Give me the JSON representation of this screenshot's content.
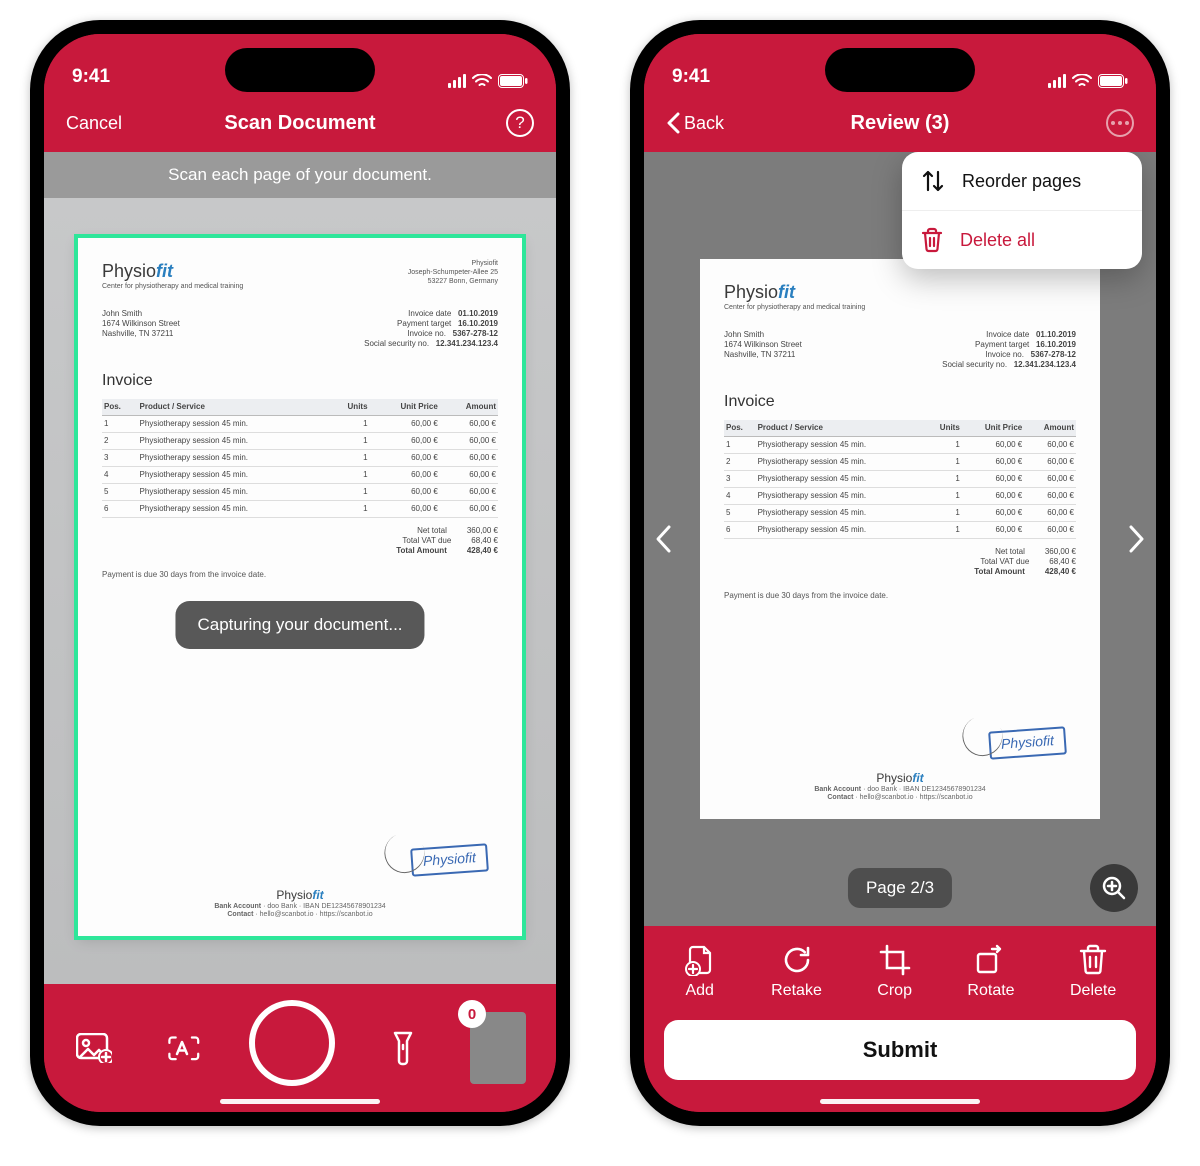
{
  "status": {
    "time": "9:41"
  },
  "scan": {
    "cancel": "Cancel",
    "title": "Scan Document",
    "hint": "Scan each page of your document.",
    "toast": "Capturing your document...",
    "thumb_count": "0"
  },
  "review": {
    "back": "Back",
    "title": "Review (3)",
    "page_chip": "Page 2/3",
    "menu": {
      "reorder": "Reorder pages",
      "delete_all": "Delete all"
    },
    "tools": {
      "add": "Add",
      "retake": "Retake",
      "crop": "Crop",
      "rotate": "Rotate",
      "delete": "Delete"
    },
    "submit": "Submit"
  },
  "doc": {
    "brand": "Physio",
    "brand_accent": "fit",
    "tag": "Center for physiotherapy and medical training",
    "company_addr": [
      "Physiofit",
      "Joseph-Schumpeter-Allee 25",
      "53227 Bonn, Germany"
    ],
    "client": [
      "John Smith",
      "1674 Wilkinson Street",
      "Nashville, TN 37211"
    ],
    "meta_labels": [
      "Invoice date",
      "Payment target",
      "Invoice no.",
      "Social security no."
    ],
    "meta_values": [
      "01.10.2019",
      "16.10.2019",
      "5367-278-12",
      "12.341.234.123.4"
    ],
    "invoice_word": "Invoice",
    "cols": [
      "Pos.",
      "Product / Service",
      "Units",
      "Unit Price",
      "Amount"
    ],
    "rows": [
      [
        "1",
        "Physiotherapy session 45 min.",
        "1",
        "60,00 €",
        "60,00 €"
      ],
      [
        "2",
        "Physiotherapy session 45 min.",
        "1",
        "60,00 €",
        "60,00 €"
      ],
      [
        "3",
        "Physiotherapy session 45 min.",
        "1",
        "60,00 €",
        "60,00 €"
      ],
      [
        "4",
        "Physiotherapy session 45 min.",
        "1",
        "60,00 €",
        "60,00 €"
      ],
      [
        "5",
        "Physiotherapy session 45 min.",
        "1",
        "60,00 €",
        "60,00 €"
      ],
      [
        "6",
        "Physiotherapy session 45 min.",
        "1",
        "60,00 €",
        "60,00 €"
      ]
    ],
    "totals": [
      [
        "Net total",
        "360,00 €"
      ],
      [
        "Total VAT due",
        "68,40 €"
      ],
      [
        "Total Amount",
        "428,40 €"
      ]
    ],
    "payment_note": "Payment is due 30 days from the invoice date.",
    "footer": [
      "Bank Account · doo Bank · IBAN DE12345678901234",
      "Contact · hello@scanbot.io · https://scanbot.io"
    ]
  }
}
